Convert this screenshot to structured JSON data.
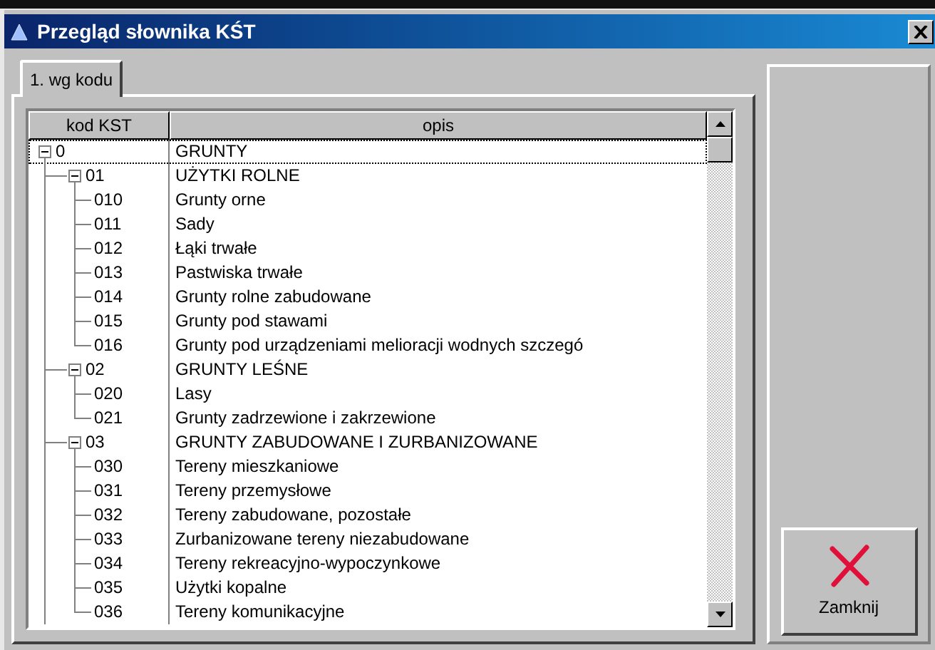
{
  "window": {
    "title": "Przegląd słownika KŚT"
  },
  "tabs": [
    {
      "label": "1. wg kodu",
      "selected": true
    }
  ],
  "table": {
    "columns": [
      "kod KST",
      "opis"
    ],
    "rows": [
      {
        "code": "0",
        "description": "GRUNTY",
        "selected": true,
        "expanded": true,
        "children": [
          {
            "code": "01",
            "description": "UŻYTKI ROLNE",
            "selected": false,
            "expanded": true,
            "children": [
              {
                "code": "010",
                "description": "Grunty orne",
                "selected": false
              },
              {
                "code": "011",
                "description": "Sady",
                "selected": false
              },
              {
                "code": "012",
                "description": "Łąki trwałe",
                "selected": false
              },
              {
                "code": "013",
                "description": "Pastwiska trwałe",
                "selected": false
              },
              {
                "code": "014",
                "description": "Grunty rolne zabudowane",
                "selected": false
              },
              {
                "code": "015",
                "description": "Grunty pod stawami",
                "selected": false
              },
              {
                "code": "016",
                "description": "Grunty pod urządzeniami melioracji wodnych szczegó",
                "selected": false
              }
            ]
          },
          {
            "code": "02",
            "description": "GRUNTY LEŚNE",
            "selected": false,
            "expanded": true,
            "children": [
              {
                "code": "020",
                "description": "Lasy",
                "selected": false
              },
              {
                "code": "021",
                "description": "Grunty zadrzewione i zakrzewione",
                "selected": false
              }
            ]
          },
          {
            "code": "03",
            "description": "GRUNTY ZABUDOWANE I ZURBANIZOWANE",
            "selected": false,
            "expanded": true,
            "children": [
              {
                "code": "030",
                "description": "Tereny mieszkaniowe",
                "selected": false
              },
              {
                "code": "031",
                "description": "Tereny przemysłowe",
                "selected": false
              },
              {
                "code": "032",
                "description": "Tereny zabudowane, pozostałe",
                "selected": false
              },
              {
                "code": "033",
                "description": "Zurbanizowane tereny niezabudowane",
                "selected": false
              },
              {
                "code": "034",
                "description": "Tereny rekreacyjno-wypoczynkowe",
                "selected": false
              },
              {
                "code": "035",
                "description": "Użytki kopalne",
                "selected": false
              },
              {
                "code": "036",
                "description": "Tereny komunikacyjne",
                "selected": false
              }
            ]
          }
        ]
      }
    ]
  },
  "buttons": [
    {
      "label": "Zamknij"
    }
  ]
}
